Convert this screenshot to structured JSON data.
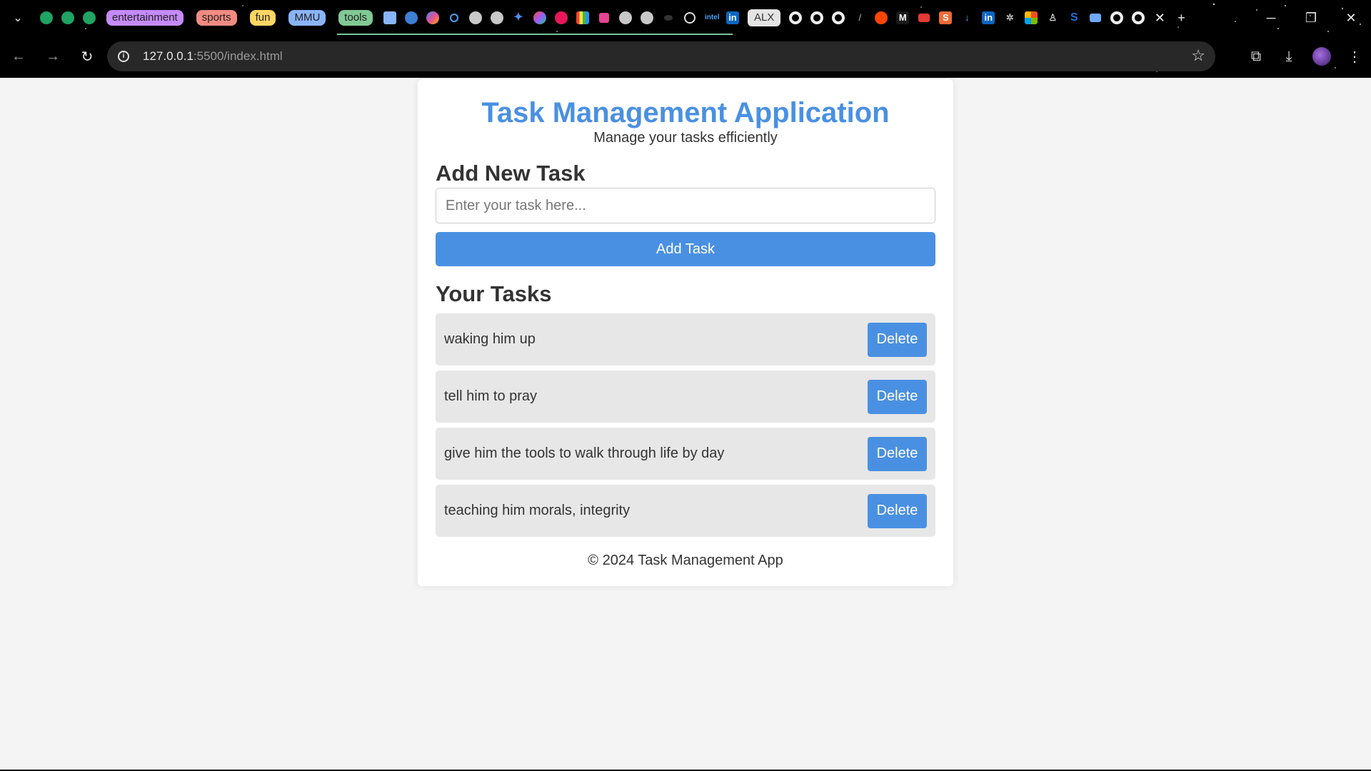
{
  "browser": {
    "url_host": "127.0.0.1",
    "url_path": ":5500/index.html",
    "tab_groups": [
      {
        "label": "entertainment",
        "color": "#c58af9"
      },
      {
        "label": "sports",
        "color": "#f28b82"
      },
      {
        "label": "fun",
        "color": "#fdd663"
      },
      {
        "label": "MMU",
        "color": "#8ab4f8"
      },
      {
        "label": "tools",
        "color": "#81c995"
      }
    ],
    "pinned_badge": "ALX"
  },
  "app": {
    "title": "Task Management Application",
    "subtitle": "Manage your tasks efficiently",
    "accent_color": "#4a90e2"
  },
  "add_section": {
    "heading": "Add New Task",
    "input_placeholder": "Enter your task here...",
    "input_value": "",
    "button_label": "Add Task"
  },
  "tasks_section": {
    "heading": "Your Tasks",
    "delete_label": "Delete",
    "tasks": [
      {
        "text": "waking him up"
      },
      {
        "text": "tell him to pray"
      },
      {
        "text": "give him the tools to walk through life by day"
      },
      {
        "text": "teaching him morals, integrity"
      }
    ]
  },
  "footer": {
    "text": "© 2024 Task Management App"
  }
}
